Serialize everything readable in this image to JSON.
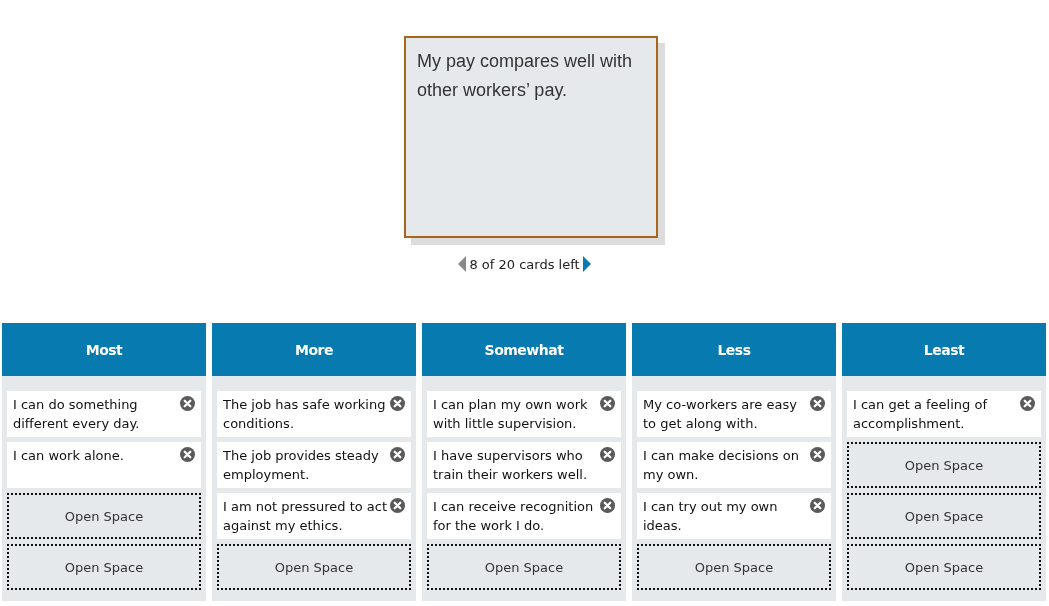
{
  "current_card": {
    "text": "My pay compares well with other workers’ pay."
  },
  "pager": {
    "text": "8 of 20 cards left",
    "prev_disabled": true,
    "next_disabled": false
  },
  "columns": [
    {
      "title": "Most",
      "slots": [
        {
          "kind": "card",
          "text": "I can do something different every day."
        },
        {
          "kind": "card",
          "text": "I can work alone."
        },
        {
          "kind": "open",
          "text": "Open Space"
        },
        {
          "kind": "open",
          "text": "Open Space"
        }
      ]
    },
    {
      "title": "More",
      "slots": [
        {
          "kind": "card",
          "text": "The job has safe working conditions."
        },
        {
          "kind": "card",
          "text": "The job provides steady employment."
        },
        {
          "kind": "card",
          "text": "I am not pressured to act against my ethics."
        },
        {
          "kind": "open",
          "text": "Open Space"
        }
      ]
    },
    {
      "title": "Somewhat",
      "slots": [
        {
          "kind": "card",
          "text": "I can plan my own work with little supervision."
        },
        {
          "kind": "card",
          "text": "I have supervisors who train their workers well."
        },
        {
          "kind": "card",
          "text": "I can receive recognition for the work I do."
        },
        {
          "kind": "open",
          "text": "Open Space"
        }
      ]
    },
    {
      "title": "Less",
      "slots": [
        {
          "kind": "card",
          "text": "My co-workers are easy to get along with."
        },
        {
          "kind": "card",
          "text": "I can make decisions on my own."
        },
        {
          "kind": "card",
          "text": "I can try out my own ideas."
        },
        {
          "kind": "open",
          "text": "Open Space"
        }
      ]
    },
    {
      "title": "Least",
      "slots": [
        {
          "kind": "card",
          "text": "I can get a feeling of accomplishment."
        },
        {
          "kind": "open",
          "text": "Open Space"
        },
        {
          "kind": "open",
          "text": "Open Space"
        },
        {
          "kind": "open",
          "text": "Open Space"
        }
      ]
    }
  ]
}
